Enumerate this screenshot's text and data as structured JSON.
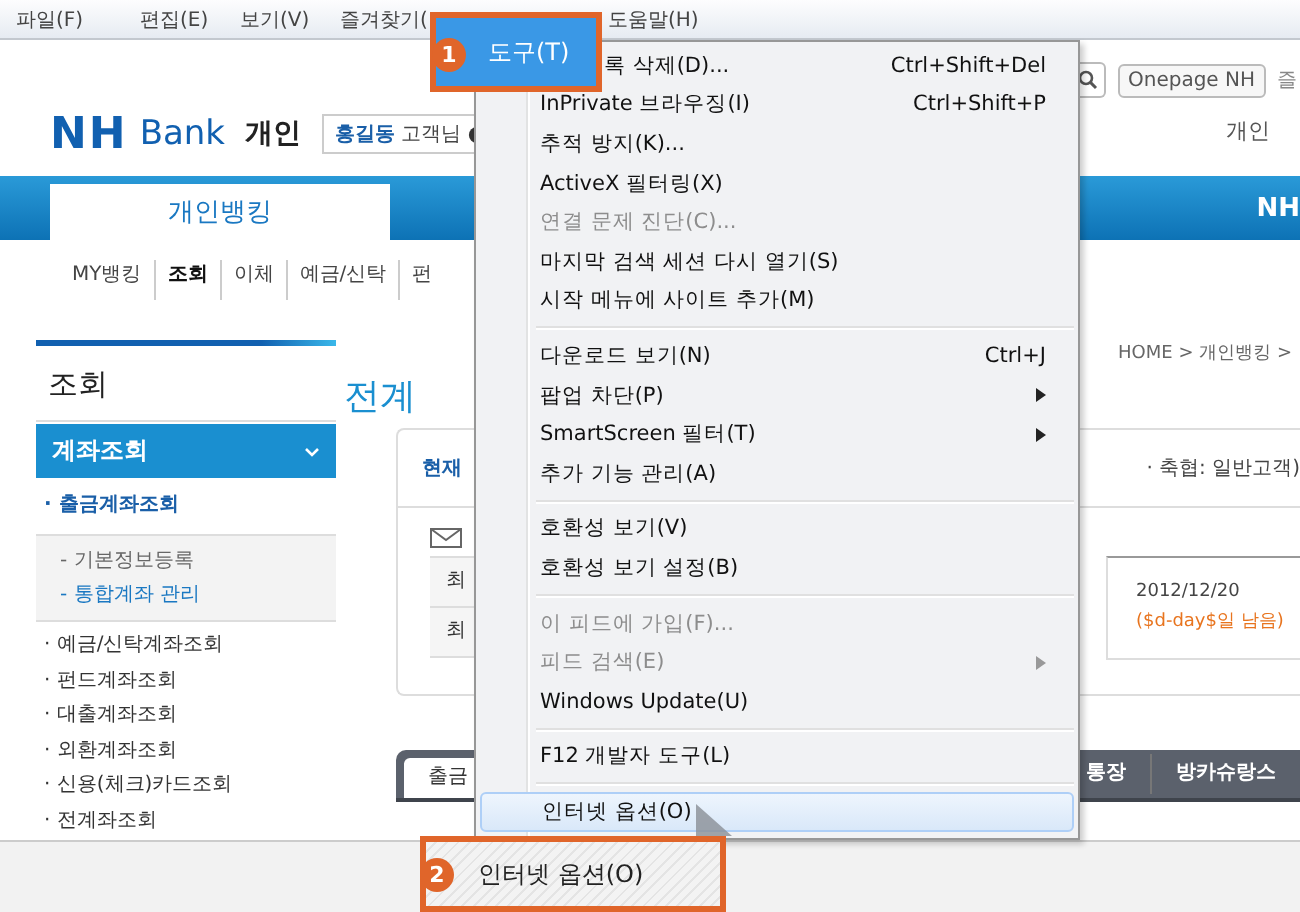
{
  "menubar": {
    "items": [
      {
        "label": "파일(F)"
      },
      {
        "label": "편집(E)"
      },
      {
        "label": "보기(V)"
      },
      {
        "label": "즐겨찾기("
      },
      {
        "label": "도움말(H)"
      }
    ]
  },
  "header": {
    "logo_mark": "NH",
    "logo_text": "Bank",
    "section": "개인",
    "user_name": "홍길동",
    "user_suffix": "고객님",
    "onepage_button": "Onepage NH",
    "favorites": "즐",
    "top_link": "개인"
  },
  "nav": {
    "tabs": [
      {
        "label": "개인뱅킹",
        "selected": true
      },
      {
        "label": "NH",
        "selected": false
      }
    ]
  },
  "subnav": [
    {
      "label": "MY뱅킹",
      "selected": false
    },
    {
      "label": "조회",
      "selected": true
    },
    {
      "label": "이체",
      "selected": false
    },
    {
      "label": "예금/신탁",
      "selected": false
    },
    {
      "label": "펀",
      "selected": false
    }
  ],
  "sidebar": {
    "title": "조회",
    "section": {
      "label": "계좌조회",
      "expanded": true
    },
    "items": [
      {
        "label": "· 출금계좌조회",
        "selected": true,
        "children": [
          {
            "label": "- 기본정보등록",
            "selected": false
          },
          {
            "label": "- 통합계좌 관리",
            "selected": true
          }
        ]
      },
      {
        "label": "· 예금/신탁계좌조회",
        "selected": false
      },
      {
        "label": "· 펀드계좌조회",
        "selected": false
      },
      {
        "label": "· 대출계좌조회",
        "selected": false
      },
      {
        "label": "· 외환계좌조회",
        "selected": false
      },
      {
        "label": "· 신용(체크)카드조회",
        "selected": false
      },
      {
        "label": "· 전계좌조회",
        "selected": false
      }
    ]
  },
  "main": {
    "breadcrumb": "HOME > 개인뱅킹 >",
    "title": "전계",
    "info_left": "현재",
    "info_right": "· 축협: 일반고객)",
    "rows": [
      {
        "cell": "최"
      },
      {
        "cell": "최"
      }
    ],
    "due_date": "2012/12/20",
    "due_note": "($d-day$일 남음)",
    "tabs": [
      {
        "label": "출금",
        "selected": true
      },
      {
        "label": "통장",
        "selected": false
      },
      {
        "label": "방카슈랑스",
        "selected": false
      }
    ]
  },
  "tools_menu": {
    "groups": [
      [
        {
          "label": "록 삭제(D)...",
          "shortcut": "Ctrl+Shift+Del",
          "disabled": false,
          "submenu": false,
          "selected": false
        },
        {
          "label": "InPrivate 브라우징(I)",
          "shortcut": "Ctrl+Shift+P",
          "disabled": false,
          "submenu": false,
          "selected": false
        },
        {
          "label": "추적 방지(K)...",
          "disabled": false,
          "submenu": false,
          "selected": false
        },
        {
          "label": "ActiveX 필터링(X)",
          "disabled": false,
          "submenu": false,
          "selected": false
        },
        {
          "label": "연결 문제 진단(C)...",
          "disabled": true,
          "submenu": false,
          "selected": false
        },
        {
          "label": "마지막 검색 세션 다시 열기(S)",
          "disabled": false,
          "submenu": false,
          "selected": false
        },
        {
          "label": "시작 메뉴에 사이트 추가(M)",
          "disabled": false,
          "submenu": false,
          "selected": false
        }
      ],
      [
        {
          "label": "다운로드 보기(N)",
          "shortcut": "Ctrl+J",
          "disabled": false,
          "submenu": false,
          "selected": false
        },
        {
          "label": "팝업 차단(P)",
          "disabled": false,
          "submenu": true,
          "selected": false
        },
        {
          "label": "SmartScreen 필터(T)",
          "disabled": false,
          "submenu": true,
          "selected": false
        },
        {
          "label": "추가 기능 관리(A)",
          "disabled": false,
          "submenu": false,
          "selected": false
        }
      ],
      [
        {
          "label": "호환성 보기(V)",
          "disabled": false,
          "submenu": false,
          "selected": false
        },
        {
          "label": "호환성 보기 설정(B)",
          "disabled": false,
          "submenu": false,
          "selected": false
        }
      ],
      [
        {
          "label": "이 피드에 가입(F)...",
          "disabled": true,
          "submenu": false,
          "selected": false
        },
        {
          "label": "피드 검색(E)",
          "disabled": true,
          "submenu": true,
          "selected": false
        },
        {
          "label": "Windows Update(U)",
          "disabled": false,
          "submenu": false,
          "selected": false
        }
      ],
      [
        {
          "label": "F12 개발자 도구(L)",
          "disabled": false,
          "submenu": false,
          "selected": false
        }
      ],
      [
        {
          "label": "인터넷 옵션(O)",
          "disabled": false,
          "submenu": false,
          "selected": true
        }
      ]
    ]
  },
  "callouts": [
    {
      "kind": "menubar",
      "number": "1",
      "label": "도구(T)"
    },
    {
      "kind": "menuitem",
      "number": "2",
      "label": "인터넷 옵션(O)"
    }
  ]
}
